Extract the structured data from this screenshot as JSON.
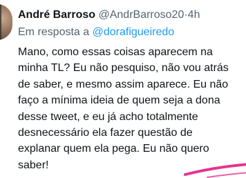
{
  "tweet": {
    "author_name": "André Barroso",
    "author_handle": "@AndrBarroso20",
    "separator": "·",
    "time": "4h",
    "reply_label": "Em resposta a",
    "reply_to": "@dorafigueiredo",
    "text_lines": [
      "Mano, como essas coisas aparecem na",
      "minha TL? Eu não pesquiso, não vou atrás",
      "de saber, e mesmo assim aparece. Eu não",
      "faço a mínima ideia de quem seja a dona",
      "desse tweet, e eu já acho totalmente",
      "desnecessário ela fazer questão de",
      "explanar quem ela pega. Eu não quero",
      "saber!"
    ]
  },
  "colors": {
    "text": "#0f1419",
    "secondary": "#536471",
    "link": "#1d9bf0",
    "accent_swoosh": "#e6338f"
  },
  "icons": {
    "avatar": "user-avatar"
  }
}
